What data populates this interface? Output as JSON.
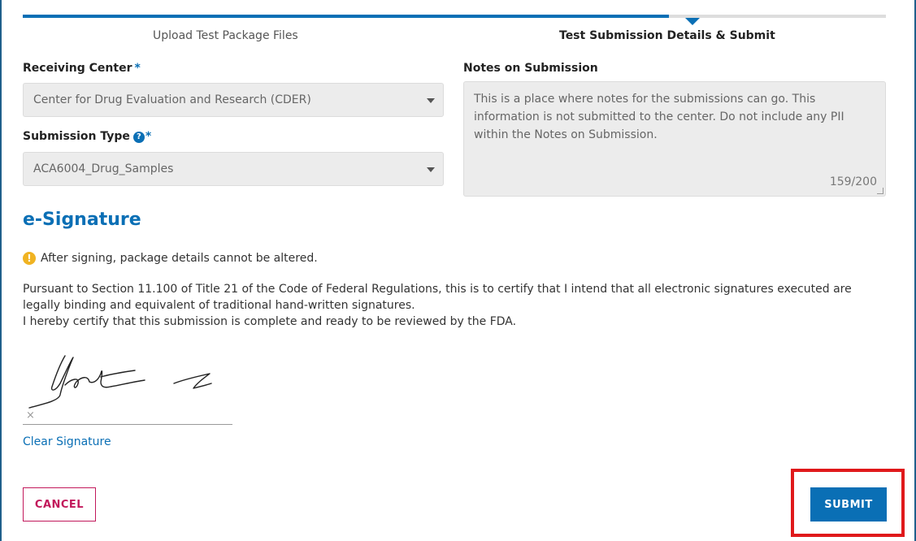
{
  "stepper": {
    "step1": "Upload Test Package Files",
    "step2": "Test Submission Details & Submit"
  },
  "form": {
    "receiving_center": {
      "label": "Receiving Center",
      "required_mark": "*",
      "value": "Center for Drug Evaluation and Research (CDER)"
    },
    "submission_type": {
      "label": "Submission Type",
      "required_mark": "*",
      "help_glyph": "?",
      "value": "ACA6004_Drug_Samples"
    },
    "notes": {
      "label": "Notes on Submission",
      "value": "This is a place where notes for the submissions can go. This information is not submitted to the center. Do not include any PII within the Notes on Submission.",
      "count": "159/200"
    }
  },
  "esignature": {
    "heading": "e-Signature",
    "warning_glyph": "!",
    "warning": "After signing, package details cannot be altered.",
    "paragraph1": "Pursuant to Section 11.100 of Title 21 of the Code of Federal Regulations, this is to certify that I intend that all electronic signatures executed are legally binding and equivalent of traditional hand-written signatures.",
    "paragraph2": "I hereby certify that this submission is complete and ready to be reviewed by the FDA.",
    "sig_x": "×",
    "clear_label": "Clear Signature"
  },
  "buttons": {
    "cancel": "CANCEL",
    "submit": "SUBMIT"
  },
  "colors": {
    "accent": "#0a6fb5",
    "cancel": "#c2185b",
    "highlight": "#e0191b",
    "warning": "#f0b322"
  }
}
